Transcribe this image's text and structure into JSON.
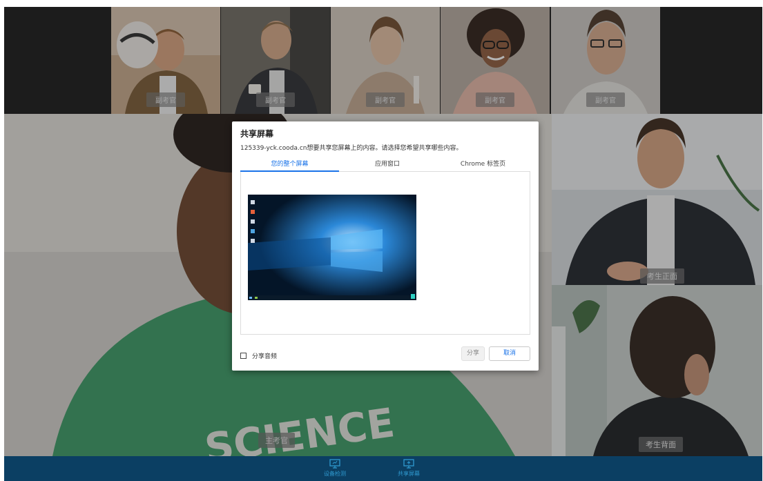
{
  "top_tiles": [
    {
      "label": "副考官"
    },
    {
      "label": "副考官"
    },
    {
      "label": "副考官"
    },
    {
      "label": "副考官"
    },
    {
      "label": "副考官"
    }
  ],
  "main": {
    "label": "主考官"
  },
  "candidate": {
    "front_label": "考生正面",
    "back_label": "考生背面"
  },
  "toolbar": {
    "items": [
      {
        "label": "设备检测",
        "icon": "monitor-icon"
      },
      {
        "label": "共享屏幕",
        "icon": "share-screen-icon"
      }
    ]
  },
  "dialog": {
    "title": "共享屏幕",
    "description": "125339-yck.cooda.cn想要共享您屏幕上的内容。请选择您希望共享哪些内容。",
    "tabs": [
      {
        "label": "您的整个屏幕",
        "active": true
      },
      {
        "label": "应用窗口",
        "active": false
      },
      {
        "label": "Chrome 标签页",
        "active": false
      }
    ],
    "share_audio_label": "分享音频",
    "share_button": "分享",
    "cancel_button": "取消"
  },
  "colors": {
    "toolbar_bg": "#0b3f63",
    "accent": "#1a73e8",
    "toolbar_text": "#2f9ad0"
  }
}
